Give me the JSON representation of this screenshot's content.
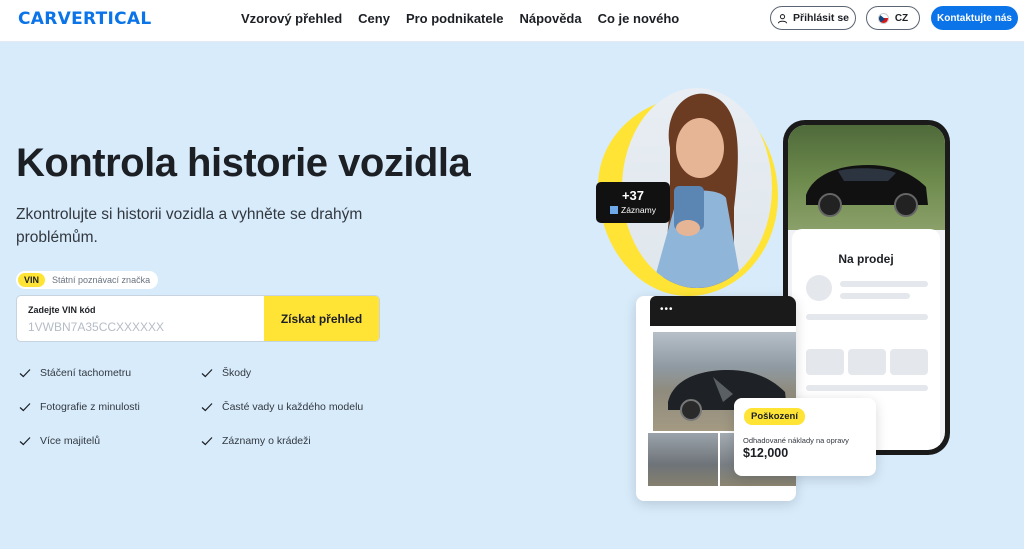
{
  "header": {
    "logo": "CARVERTICAL",
    "nav": [
      "Vzorový přehled",
      "Ceny",
      "Pro podnikatele",
      "Nápověda",
      "Co je nového"
    ],
    "login_label": "Přihlásit se",
    "language": "CZ",
    "contact_label": "Kontaktujte nás"
  },
  "hero": {
    "title": "Kontrola historie vozidla",
    "subtitle": "Zkontrolujte si historii vozidla a vyhněte se drahým problémům.",
    "toggle": {
      "vin_label": "VIN",
      "plate_label": "Státní poznávací značka"
    },
    "search": {
      "label": "Zadejte VIN kód",
      "placeholder": "1VWBN7A35CCXXXXXX",
      "button_label": "Získat přehled"
    },
    "features": [
      "Stáčení tachometru",
      "Škody",
      "Fotografie z minulosti",
      "Časté vady u každého modelu",
      "Více majitelů",
      "Záznamy o krádeži"
    ]
  },
  "illustration": {
    "records_count": "+37",
    "records_label": "Záznamy",
    "for_sale_title": "Na prodej",
    "damage_tag": "Poškození",
    "estimate_label": "Odhadované náklady na opravy",
    "estimate_amount": "$12,000"
  },
  "colors": {
    "brand_blue": "#0a74e8",
    "accent_yellow": "#ffe436",
    "hero_bg": "#d7ebfb"
  }
}
